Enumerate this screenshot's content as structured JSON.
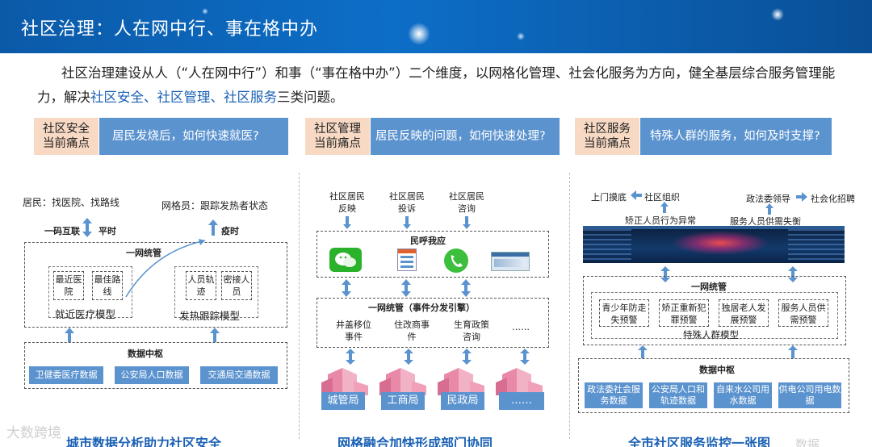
{
  "header": {
    "title": "社区治理：人在网中行、事在格中办"
  },
  "intro": {
    "p1": "社区治理建设从人（“人在网中行”）和事（“事在格中办”）二个维度，以网格化管理、社会化服务为方向，健全基层综合服务管理能力，解决",
    "hl1": "社区安全、社区管理、社区服务",
    "p2": "三类问题。"
  },
  "pain": [
    {
      "tag_line1": "社区安全",
      "tag_line2": "当前痛点",
      "question": "居民发烧后，如何快速就医?"
    },
    {
      "tag_line1": "社区管理",
      "tag_line2": "当前痛点",
      "question": "居民反映的问题，如何快速处理?"
    },
    {
      "tag_line1": "社区服务",
      "tag_line2": "当前痛点",
      "question": "特殊人群的服务，如何及时支撑?"
    }
  ],
  "safety": {
    "resident": "居民：找医院、找路线",
    "gridman": "网格员：跟踪发热者状态",
    "arrow1_left": "一码互联",
    "arrow1_right": "平时",
    "arrow2_right": "疫时",
    "unify": "一网统管",
    "m1a": "最近医院",
    "m1b": "最佳路线",
    "m1_title": "就近医疗模型",
    "m2a": "人员轨迹",
    "m2b": "密接人员",
    "m2_title": "发热跟踪模型",
    "hub": "数据中枢",
    "src1": "卫健委医疗数据",
    "src2": "公安局人口数据",
    "src3": "交通局交通数据",
    "caption": "城市数据分析助力社区安全"
  },
  "manage": {
    "in1": "社区居民反映",
    "in2": "社区居民投诉",
    "in3": "社区居民咨询",
    "hotline": "民呼我应",
    "unify": "一网统管（事件分发引擎）",
    "e1": "井盖移位事件",
    "e2": "住改商事件",
    "e3": "生育政策咨询",
    "e4": "……",
    "d1": "城管局",
    "d2": "工商局",
    "d3": "民政局",
    "d4": "……",
    "caption": "网格融合加快形成部门协同"
  },
  "service": {
    "top1": "上门摸底",
    "top2": "社区组织",
    "top3": "政法委领导",
    "top4": "社会化招聘",
    "sub1": "矫正人员行为异常",
    "sub2": "服务人员供需失衡",
    "unify": "一网统管",
    "w1": "青少年防走失预警",
    "w2": "矫正重新犯罪预警",
    "w3": "独居老人发展预警",
    "w4": "服务人员供需预警",
    "model": "特殊人群模型",
    "hub": "数据中枢",
    "s1": "政法委社会服务数据",
    "s2": "公安局人口和轨迹数据",
    "s3": "自来水公司用水数据",
    "s4": "供电公司用电数据",
    "caption": "全市社区服务监控一张图"
  },
  "watermark": {
    "left": "大数跨境",
    "right": "数据..."
  },
  "colors": {
    "header_blue": "#0d6ec7",
    "pain_blue": "#5b93cf",
    "pain_tag": "#f7d9c4",
    "highlight": "#1a61b5",
    "arrow_blue": "#5b93cf"
  }
}
